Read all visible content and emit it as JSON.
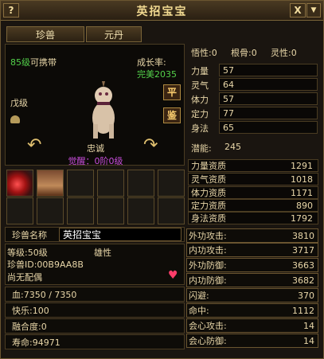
{
  "window": {
    "title": "英招宝宝",
    "help": "?",
    "close": "X",
    "dropdown": "▼"
  },
  "tabs": [
    "珍兽",
    "元丹"
  ],
  "pet": {
    "level_carry": "85级",
    "carry_text": "可携带",
    "growth_label": "成长率:",
    "growth_value": "完美2035",
    "grade": "戊级",
    "btn_ping": "平",
    "btn_jian": "鉴",
    "name_trait": "忠诚",
    "awaken": "觉醒：0阶0级"
  },
  "name_row": {
    "label": "珍兽名称",
    "value": "英招宝宝"
  },
  "info": {
    "level": "等级:50级",
    "gender": "雄性",
    "pet_id": "珍兽ID:00B9AA8B",
    "spouse": "尚无配偶"
  },
  "vitals": {
    "hp": "血:7350 / 7350",
    "happy": "快乐:100",
    "fusion": "融合度:0",
    "life": "寿命:94971"
  },
  "top_right": {
    "wuxing": "悟性:0",
    "genggu": "根骨:0",
    "lingxing": "灵性:0"
  },
  "attrs": [
    {
      "label": "力量",
      "value": "57"
    },
    {
      "label": "灵气",
      "value": "64"
    },
    {
      "label": "体力",
      "value": "57"
    },
    {
      "label": "定力",
      "value": "77"
    },
    {
      "label": "身法",
      "value": "65"
    }
  ],
  "potential": {
    "label": "潜能:",
    "value": "245"
  },
  "aptitudes": [
    {
      "label": "力量资质",
      "value": "1291"
    },
    {
      "label": "灵气资质",
      "value": "1018"
    },
    {
      "label": "体力资质",
      "value": "1171"
    },
    {
      "label": "定力资质",
      "value": "890"
    },
    {
      "label": "身法资质",
      "value": "1792"
    }
  ],
  "stats": [
    {
      "label": "外功攻击:",
      "value": "3810"
    },
    {
      "label": "内功攻击:",
      "value": "3717"
    },
    {
      "label": "外功防御:",
      "value": "3663"
    },
    {
      "label": "内功防御:",
      "value": "3682"
    },
    {
      "label": "闪避:",
      "value": "370"
    },
    {
      "label": "命中:",
      "value": "1112"
    },
    {
      "label": "会心攻击:",
      "value": "14"
    },
    {
      "label": "会心防御:",
      "value": "14"
    }
  ]
}
